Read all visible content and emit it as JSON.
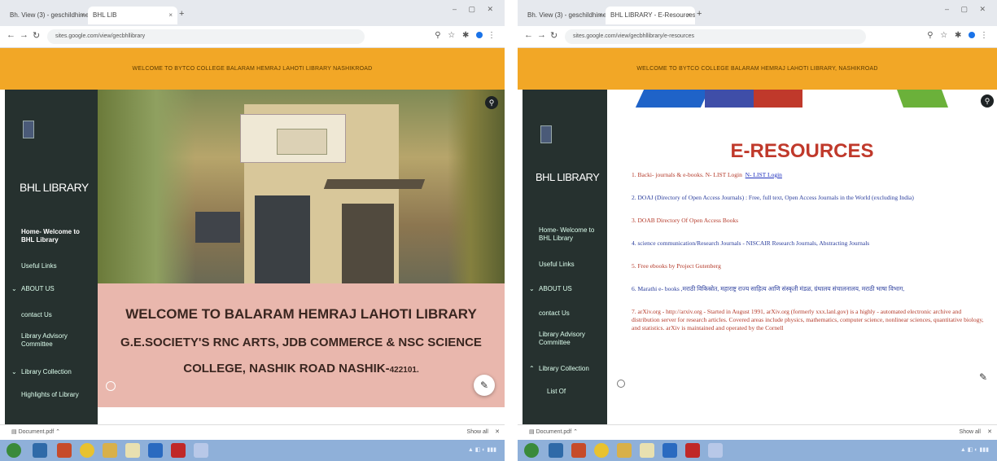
{
  "left": {
    "tabs": [
      "Bh. View (3) - geschildhime@...",
      "BHL LIB"
    ],
    "url": "sites.google.com/view/gecbhllibrary",
    "banner": "WELCOME TO BYTCO COLLEGE BALARAM HEMRAJ LAHOTI LIBRARY NASHIKROAD",
    "sidebar": {
      "title": "BHL LIBRARY",
      "items": [
        "Home- Welcome to",
        "BHL Library",
        "Useful Links",
        "ABOUT US",
        "contact Us",
        "Library Advisory",
        "Committee",
        "Library Collection",
        "Highlights of Library"
      ]
    },
    "welcome": {
      "line1": "WELCOME TO BALARAM HEMRAJ LAHOTI LIBRARY",
      "line2": "G.E.SOCIETY'S RNC ARTS, JDB COMMERCE & NSC SCIENCE",
      "line3": "COLLEGE, NASHIK ROAD NASHIK-",
      "pin": "422101."
    },
    "download": "Document.pdf",
    "show_all": "Show all"
  },
  "right": {
    "tabs": [
      "Bh. View (3) - geschildhime@...",
      "BHL LIBRARY - E-Resources"
    ],
    "url": "sites.google.com/view/gecbhllibrary/e-resources",
    "banner": "WELCOME TO BYTCO COLLEGE BALARAM HEMRAJ LAHOTI LIBRARY, NASHIKROAD",
    "sidebar": {
      "title": "BHL LIBRARY",
      "items": [
        "Home- Welcome to",
        "BHL Library",
        "Useful Links",
        "ABOUT US",
        "contact Us",
        "Library Advisory",
        "Committee",
        "Library Collection",
        "List Of"
      ]
    },
    "heading": "E-RESOURCES",
    "resources": [
      "1. Backi- journals & e-books. N- LIST Login",
      "N- LIST Login",
      "2. DOAJ (Directory of Open Access Journals) : Free, full text, Open Access Journals in the World (excluding India)",
      "3. DOAB Directory Of Open Access Books",
      "4. science communication/Research Journals - NISCAIR Research Journals, Abstracting Journals",
      "5. Free ebooks by Project Gutenberg",
      "6. Marathi e- books ,मराठी विकिस्रोत, महाराष्ट्र राज्य साहित्य आणि संस्कृती मंडळ, ग्रंथालय संचालनालय, मराठी भाषा विभाग,",
      "7. arXiv.org - http://arxiv.org - Started in August 1991, arXiv.org (formerly xxx.lanl.gov) is a highly - automated electronic archive and distribution server for research articles. Covered areas include physics, mathematics, computer science, nonlinear sciences, quantitative biology, and statistics. arXiv is maintained and operated by the Cornell"
    ],
    "download": "Document.pdf",
    "show_all": "Show all"
  },
  "colors": {
    "banner": "#f2a726",
    "sidebar": "#26312f",
    "welcome_bg": "#e9b7ad",
    "heading": "#c0392b",
    "taskbar": "#8fb0d9"
  }
}
